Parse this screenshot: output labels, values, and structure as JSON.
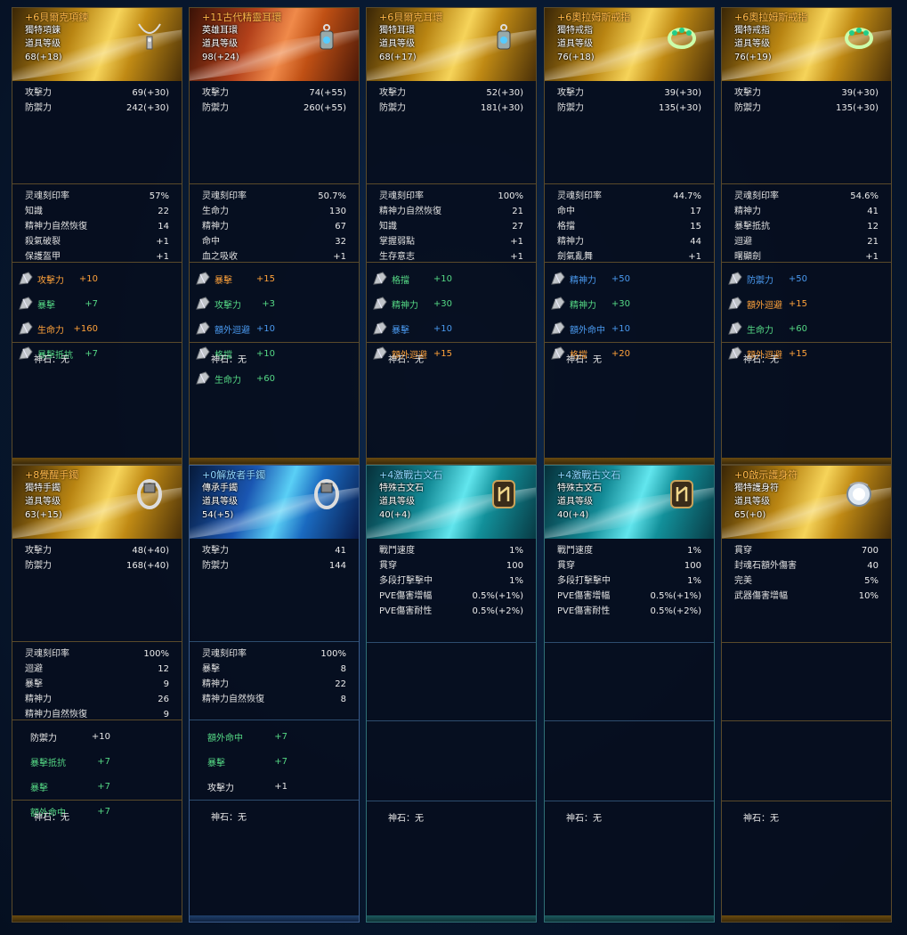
{
  "colors": {
    "orange": "#ffa23a",
    "green": "#55d985",
    "teal": "#4fd2c2",
    "blue": "#4a9af0",
    "white": "#e6e6e6"
  },
  "cards": [
    {
      "name": "+6貝爾克項鍊",
      "type": "獨特項鍊",
      "level_label": "道具等级",
      "level": "68(+18)",
      "icon": "necklace-icon",
      "base": [
        {
          "label": "攻擊力",
          "value": "69(+30)"
        },
        {
          "label": "防禦力",
          "value": "242(+30)"
        }
      ],
      "soul": [
        {
          "label": "灵魂刻印率",
          "value": "57%"
        },
        {
          "label": "知識",
          "value": "22"
        },
        {
          "label": "精神力自然恢復",
          "value": "14"
        },
        {
          "label": "殺氣破裂",
          "value": "+1"
        },
        {
          "label": "保護盔甲",
          "value": "+1"
        }
      ],
      "engrave": [
        {
          "label": "攻擊力",
          "value": "+10",
          "color": "orange",
          "gem": true
        },
        {
          "label": "暴擊",
          "value": "+7",
          "color": "green",
          "gem": true
        },
        {
          "label": "生命力",
          "value": "+160",
          "color": "orange",
          "gem": true
        },
        {
          "label": "暴擊抵抗",
          "value": "+7",
          "color": "green",
          "gem": true
        }
      ],
      "stone": "神石：无"
    },
    {
      "name": "+11古代精靈耳環",
      "type": "英雄耳環",
      "level_label": "道具等级",
      "level": "98(+24)",
      "icon": "earring-icon",
      "base": [
        {
          "label": "攻擊力",
          "value": "74(+55)"
        },
        {
          "label": "防禦力",
          "value": "260(+55)"
        }
      ],
      "soul": [
        {
          "label": "灵魂刻印率",
          "value": "50.7%"
        },
        {
          "label": "生命力",
          "value": "130"
        },
        {
          "label": "精神力",
          "value": "67"
        },
        {
          "label": "命中",
          "value": "32"
        },
        {
          "label": "血之吸收",
          "value": "+1"
        }
      ],
      "engrave": [
        {
          "label": "暴擊",
          "value": "+15",
          "color": "orange",
          "gem": true
        },
        {
          "label": "攻擊力",
          "value": "+3",
          "color": "green",
          "gem": true
        },
        {
          "label": "額外迴避",
          "value": "+10",
          "color": "blue",
          "gem": true
        },
        {
          "label": "格擋",
          "value": "+10",
          "color": "green",
          "gem": true
        },
        {
          "label": "生命力",
          "value": "+60",
          "color": "green",
          "gem": true
        }
      ],
      "stone": "神石：无"
    },
    {
      "name": "+6貝爾克耳環",
      "type": "獨特耳環",
      "level_label": "道具等级",
      "level": "68(+17)",
      "icon": "earring-icon",
      "base": [
        {
          "label": "攻擊力",
          "value": "52(+30)"
        },
        {
          "label": "防禦力",
          "value": "181(+30)"
        }
      ],
      "soul": [
        {
          "label": "灵魂刻印率",
          "value": "100%"
        },
        {
          "label": "精神力自然恢復",
          "value": "21"
        },
        {
          "label": "知識",
          "value": "27"
        },
        {
          "label": "掌握弱點",
          "value": "+1"
        },
        {
          "label": "生存意志",
          "value": "+1"
        }
      ],
      "engrave": [
        {
          "label": "格擋",
          "value": "+10",
          "color": "green",
          "gem": true
        },
        {
          "label": "精神力",
          "value": "+30",
          "color": "green",
          "gem": true
        },
        {
          "label": "暴擊",
          "value": "+10",
          "color": "blue",
          "gem": true
        },
        {
          "label": "額外迴避",
          "value": "+15",
          "color": "orange",
          "gem": true
        }
      ],
      "stone": "神石：无"
    },
    {
      "name": "+6奧拉姆斯戒指",
      "type": "獨特戒指",
      "level_label": "道具等级",
      "level": "76(+18)",
      "icon": "ring-icon",
      "base": [
        {
          "label": "攻擊力",
          "value": "39(+30)"
        },
        {
          "label": "防禦力",
          "value": "135(+30)"
        }
      ],
      "soul": [
        {
          "label": "灵魂刻印率",
          "value": "44.7%"
        },
        {
          "label": "命中",
          "value": "17"
        },
        {
          "label": "格擋",
          "value": "15"
        },
        {
          "label": "精神力",
          "value": "44"
        },
        {
          "label": "劍氣亂舞",
          "value": "+1"
        }
      ],
      "engrave": [
        {
          "label": "精神力",
          "value": "+50",
          "color": "blue",
          "gem": true
        },
        {
          "label": "精神力",
          "value": "+30",
          "color": "green",
          "gem": true
        },
        {
          "label": "額外命中",
          "value": "+10",
          "color": "blue",
          "gem": true
        },
        {
          "label": "格擋",
          "value": "+20",
          "color": "orange",
          "gem": true
        }
      ],
      "stone": "神石：无"
    },
    {
      "name": "+6奧拉姆斯戒指",
      "type": "獨特戒指",
      "level_label": "道具等级",
      "level": "76(+19)",
      "icon": "ring-icon",
      "base": [
        {
          "label": "攻擊力",
          "value": "39(+30)"
        },
        {
          "label": "防禦力",
          "value": "135(+30)"
        }
      ],
      "soul": [
        {
          "label": "灵魂刻印率",
          "value": "54.6%"
        },
        {
          "label": "精神力",
          "value": "41"
        },
        {
          "label": "暴擊抵抗",
          "value": "12"
        },
        {
          "label": "迴避",
          "value": "21"
        },
        {
          "label": "曙顯劍",
          "value": "+1"
        }
      ],
      "engrave": [
        {
          "label": "防禦力",
          "value": "+50",
          "color": "blue",
          "gem": true
        },
        {
          "label": "額外迴避",
          "value": "+15",
          "color": "orange",
          "gem": true
        },
        {
          "label": "生命力",
          "value": "+60",
          "color": "green",
          "gem": true
        },
        {
          "label": "額外迴避",
          "value": "+15",
          "color": "orange",
          "gem": true
        }
      ],
      "stone": "神石：无"
    },
    {
      "name": "+8覺醒手鐲",
      "type": "獨特手鐲",
      "level_label": "道具等级",
      "level": "63(+15)",
      "icon": "bracelet-icon",
      "base": [
        {
          "label": "攻擊力",
          "value": "48(+40)"
        },
        {
          "label": "防禦力",
          "value": "168(+40)"
        }
      ],
      "soul": [
        {
          "label": "灵魂刻印率",
          "value": "100%"
        },
        {
          "label": "迴避",
          "value": "12"
        },
        {
          "label": "暴擊",
          "value": "9"
        },
        {
          "label": "精神力",
          "value": "26"
        },
        {
          "label": "精神力自然恢復",
          "value": "9"
        }
      ],
      "engrave": [
        {
          "label": "防禦力",
          "value": "+10",
          "color": "white",
          "gem": false
        },
        {
          "label": "暴擊抵抗",
          "value": "+7",
          "color": "green",
          "gem": false
        },
        {
          "label": "暴擊",
          "value": "+7",
          "color": "green",
          "gem": false
        },
        {
          "label": "額外命中",
          "value": "+7",
          "color": "green",
          "gem": false
        }
      ],
      "stone": "神石：无"
    },
    {
      "name": "+0解放者手鐲",
      "type": "傳承手鐲",
      "level_label": "道具等级",
      "level": "54(+5)",
      "icon": "bracelet-icon",
      "base": [
        {
          "label": "攻擊力",
          "value": "41"
        },
        {
          "label": "防禦力",
          "value": "144"
        }
      ],
      "soul": [
        {
          "label": "灵魂刻印率",
          "value": "100%"
        },
        {
          "label": "暴擊",
          "value": "8"
        },
        {
          "label": "精神力",
          "value": "22"
        },
        {
          "label": "精神力自然恢復",
          "value": "8"
        }
      ],
      "engrave": [
        {
          "label": "額外命中",
          "value": "+7",
          "color": "green",
          "gem": false
        },
        {
          "label": "暴擊",
          "value": "+7",
          "color": "green",
          "gem": false
        },
        {
          "label": "攻擊力",
          "value": "+1",
          "color": "white",
          "gem": false
        }
      ],
      "stone": "神石：无"
    },
    {
      "name": "+4激戰古文石",
      "type": "特殊古文石",
      "level_label": "道具等级",
      "level": "40(+4)",
      "icon": "rune-stone-icon",
      "base": [
        {
          "label": "戰鬥速度",
          "value": "1%"
        },
        {
          "label": "貫穿",
          "value": "100"
        },
        {
          "label": "多段打擊擊中",
          "value": "1%"
        },
        {
          "label": "PVE傷害增幅",
          "value": "0.5%(+1%)"
        },
        {
          "label": "PVE傷害耐性",
          "value": "0.5%(+2%)"
        }
      ],
      "soul": [],
      "engrave": [],
      "stone": "神石：无"
    },
    {
      "name": "+4激戰古文石",
      "type": "特殊古文石",
      "level_label": "道具等级",
      "level": "40(+4)",
      "icon": "rune-stone-icon",
      "base": [
        {
          "label": "戰鬥速度",
          "value": "1%"
        },
        {
          "label": "貫穿",
          "value": "100"
        },
        {
          "label": "多段打擊擊中",
          "value": "1%"
        },
        {
          "label": "PVE傷害增幅",
          "value": "0.5%(+1%)"
        },
        {
          "label": "PVE傷害耐性",
          "value": "0.5%(+2%)"
        }
      ],
      "soul": [],
      "engrave": [],
      "stone": "神石：无"
    },
    {
      "name": "+0啟示護身符",
      "type": "獨特護身符",
      "level_label": "道具等级",
      "level": "65(+0)",
      "icon": "amulet-icon",
      "base": [
        {
          "label": "貫穿",
          "value": "700"
        },
        {
          "label": "封魂石額外傷害",
          "value": "40"
        },
        {
          "label": "完美",
          "value": "5%"
        },
        {
          "label": "武器傷害增幅",
          "value": "10%"
        }
      ],
      "soul": [],
      "engrave": [],
      "stone": "神石：无"
    }
  ]
}
